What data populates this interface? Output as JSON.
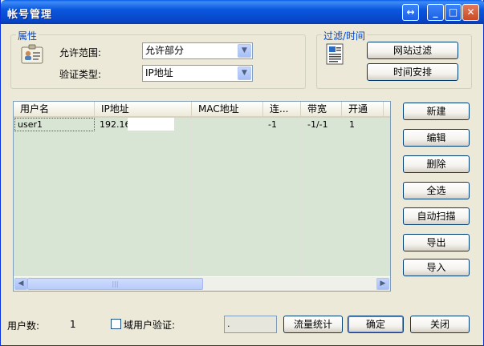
{
  "window": {
    "title": "帐号管理"
  },
  "attributes": {
    "group_label": "属性",
    "scope_label": "允许范围:",
    "scope_value": "允许部分",
    "auth_label": "验证类型:",
    "auth_value": "IP地址"
  },
  "filter": {
    "group_label": "过滤/时间",
    "web_filter_button": "网站过滤",
    "schedule_button": "时间安排"
  },
  "table": {
    "columns": [
      "用户名",
      "IP地址",
      "MAC地址",
      "连...",
      "带宽",
      "开通"
    ],
    "rows": [
      {
        "user": "user1",
        "ip": "192.16",
        "mac": "",
        "conn": "-1",
        "bandwidth": "-1/-1",
        "enabled": "1"
      }
    ]
  },
  "actions": {
    "new": "新建",
    "edit": "编辑",
    "delete": "删除",
    "select_all": "全选",
    "auto_scan": "自动扫描",
    "export": "导出",
    "import": "导入"
  },
  "footer": {
    "user_count_label": "用户数:",
    "user_count_value": "1",
    "domain_auth_label": "域用户验证:",
    "domain_auth_field_value": ".",
    "traffic_stats_button": "流量统计",
    "ok_button": "确定",
    "close_button": "关闭"
  },
  "colors": {
    "titlebar": "#0a57dd",
    "group_label": "#0046d5",
    "row_fill": "#d9e5d4"
  }
}
